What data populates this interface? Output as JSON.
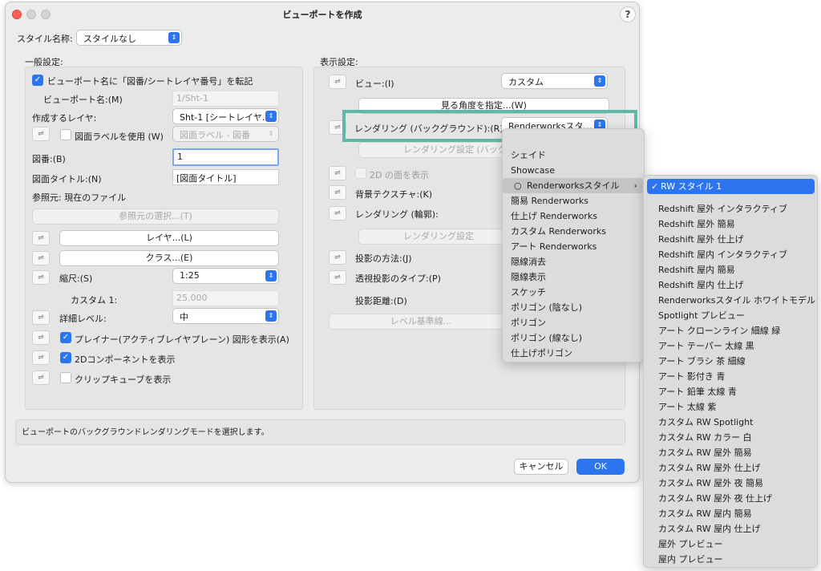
{
  "window": {
    "title": "ビューポートを作成",
    "help": "?"
  },
  "style": {
    "label": "スタイル名称:",
    "value": "スタイルなし"
  },
  "general": {
    "heading": "一般設定:",
    "transfer_check": "ビューポート名に「図番/シートレイヤ番号」を転記",
    "vp_name_label": "ビューポート名:(M)",
    "vp_name_value": "1/Sht-1",
    "layer_label": "作成するレイヤ:",
    "layer_value": "Sht-1 [シートレイヤ…",
    "drawing_label_check": "図面ラベルを使用 (W)",
    "drawing_label_value": "図面ラベル - 図番",
    "number_label": "図番:(B)",
    "number_value": "1",
    "title_label": "図面タイトル:(N)",
    "title_value": "[図面タイトル]",
    "ref_label": "参照元: 現在のファイル",
    "ref_select_button": "参照元の選択...(T)",
    "layer_button": "レイヤ...(L)",
    "class_button": "クラス...(E)",
    "scale_label": "縮尺:(S)",
    "scale_value": "1:25",
    "custom_label": "カスタム 1:",
    "custom_value": "25.000",
    "detail_label": "詳細レベル:",
    "detail_value": "中",
    "planar_check": "プレイナー(アクティブレイヤプレーン) 図形を表示(A)",
    "component_check": "2Dコンポーネントを表示",
    "clip_check": "クリップキューブを表示"
  },
  "display": {
    "heading": "表示設定:",
    "view_label": "ビュー:(I)",
    "view_value": "カスタム",
    "angle_button": "見る角度を指定...(W)",
    "render_bg_label": "レンダリング (バックグラウンド):(R)",
    "render_bg_value": "Renderworksスタ…",
    "render_settings_button": "レンダリング設定 (バックグ",
    "twod_check": "2D の面を表示",
    "bg_texture_label": "背景テクスチャ:(K)",
    "render_line_label": "レンダリング (輪郭):",
    "render_settings_button2": "レンダリング設定",
    "projection_label": "投影の方法:(J)",
    "persp_label": "透視投影のタイプ:(P)",
    "distance_label": "投影距離:(D)",
    "level_button": "レベル基準線..."
  },
  "status_text": "ビューポートのバックグラウンドレンダリングモードを選択します。",
  "buttons": {
    "cancel": "キャンセル",
    "ok": "OK"
  },
  "render_menu": {
    "items": [
      "シェイド",
      "Showcase",
      "Renderworksスタイル",
      "簡易 Renderworks",
      "仕上げ Renderworks",
      "カスタム Renderworks",
      "アート Renderworks",
      "隠線消去",
      "隠線表示",
      "スケッチ",
      "ポリゴン (陰なし)",
      "ポリゴン",
      "ポリゴン (線なし)",
      "仕上げポリゴン"
    ],
    "current_index": 2
  },
  "style_menu": {
    "checkmark": "✓",
    "items": [
      "RW スタイル 1",
      "Redshift 屋外 インタラクティブ",
      "Redshift 屋外 簡易",
      "Redshift 屋外 仕上げ",
      "Redshift 屋内 インタラクティブ",
      "Redshift 屋内 簡易",
      "Redshift 屋内 仕上げ",
      "Renderworksスタイル ホワイトモデル",
      "Spotlight プレビュー",
      "アート クローンライン 細線 緑",
      "アート テーパー 太線 黒",
      "アート ブラシ 茶 細線",
      "アート 影付き 青",
      "アート 鉛筆 太線 青",
      "アート 太線 紫",
      "カスタム RW Spotlight",
      "カスタム RW カラー 白",
      "カスタム RW 屋外 簡易",
      "カスタム RW 屋外 仕上げ",
      "カスタム RW 屋外 夜 簡易",
      "カスタム RW 屋外 夜 仕上げ",
      "カスタム RW 屋内 簡易",
      "カスタム RW 屋内 仕上げ",
      "屋外 プレビュー",
      "屋内 プレビュー"
    ]
  }
}
